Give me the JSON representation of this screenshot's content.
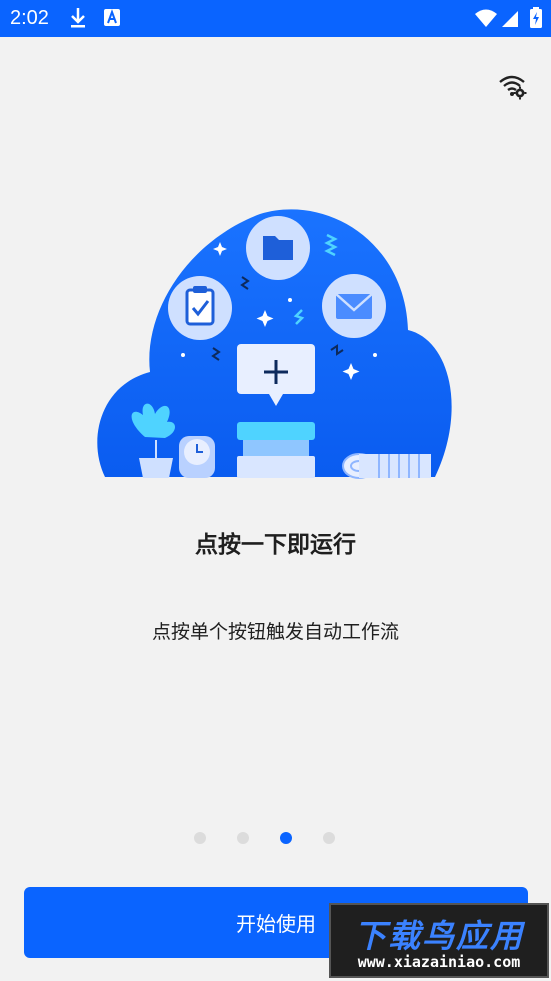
{
  "status_bar": {
    "time": "2:02"
  },
  "onboarding": {
    "title": "点按一下即运行",
    "subtitle": "点按单个按钮触发自动工作流",
    "pages": 4,
    "current_page": 3
  },
  "actions": {
    "start_label": "开始使用"
  },
  "watermark": {
    "main": "下载鸟应用",
    "url": "www.xiazainiao.com"
  },
  "colors": {
    "accent": "#0a64ff",
    "background": "#f2f2f2"
  }
}
